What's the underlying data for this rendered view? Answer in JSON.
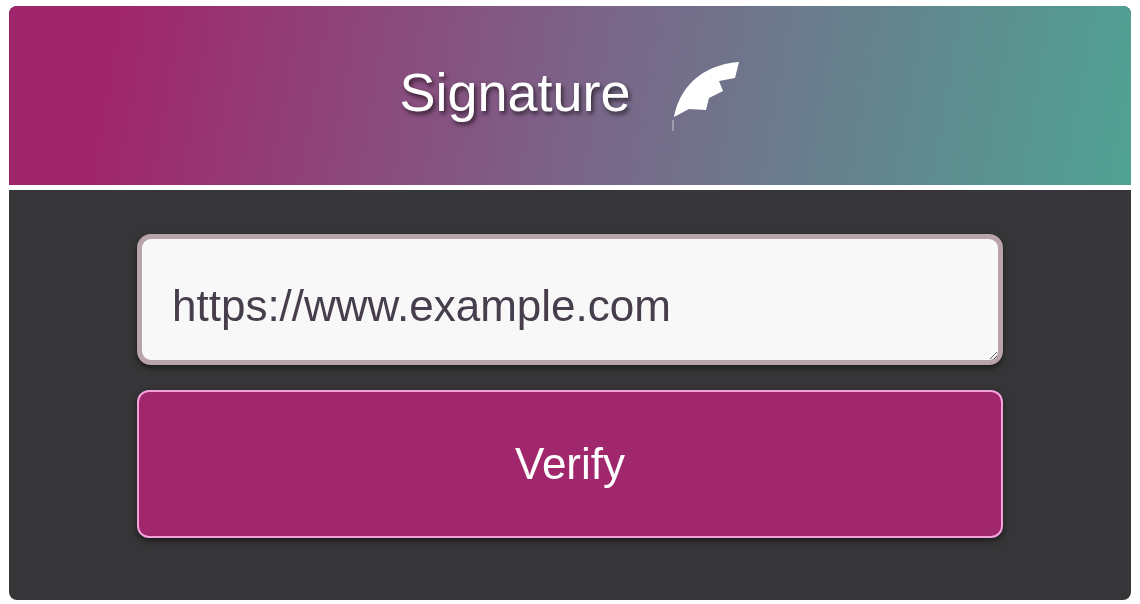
{
  "header": {
    "title": "Signature"
  },
  "url_field": {
    "value": "https://www.example.com"
  },
  "button": {
    "label": "Verify"
  }
}
